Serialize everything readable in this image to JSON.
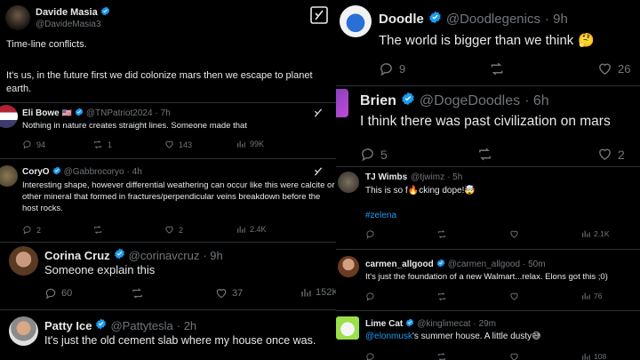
{
  "colors": {
    "background": "#000000",
    "text": "#e7e9ea",
    "muted": "#71767b",
    "verified": "#1d9bf0",
    "link": "#1d9bf0",
    "divider": "#2f3336"
  },
  "top_post": {
    "name": "Davide Masia",
    "handle": "@DavideMasia3",
    "text1": "Time-line conflicts.",
    "text2": "It's us, in the future first we did colonize mars then we escape to planet earth."
  },
  "left": [
    {
      "name": "Eli Bowe",
      "flag": "🇺🇸",
      "handle": "@TNPatriot2024",
      "time": "· 7h",
      "text": "Nothing in nature creates straight lines. Someone made that",
      "replies": "94",
      "reposts": "1",
      "likes": "143",
      "views": "99K"
    },
    {
      "name": "CoryO",
      "handle": "@Gabbrocoryo",
      "time": "· 4h",
      "text": "Interesting shape, however differential weathering can occur like this were calcite or other mineral that formed in fractures/perpendicular veins breakdown before the host rocks.",
      "replies": "2",
      "reposts": "",
      "likes": "2",
      "views": "2.4K"
    },
    {
      "name": "Corina Cruz",
      "handle": "@corinavcruz",
      "time": "· 9h",
      "text": "Someone explain this",
      "replies": "60",
      "reposts": "",
      "likes": "37",
      "views": "152K"
    },
    {
      "name": "Patty Ice",
      "handle": "@Pattytesla",
      "time": "· 2h",
      "text": "It's just the old cement slab where my house once was."
    }
  ],
  "right": [
    {
      "name": "Doodle",
      "handle": "@Doodlegenics",
      "time": "· 9h",
      "text": "The world is bigger than we think",
      "emoji": "🤔",
      "replies": "9",
      "reposts": "",
      "likes": "26"
    },
    {
      "name": "Brien",
      "handle": "@DogeDoodles",
      "time": "· 6h",
      "text": "I think there was past civilization on mars",
      "replies": "5",
      "reposts": "",
      "likes": "2"
    },
    {
      "name": "TJ Wimbs",
      "handle": "@tjwimz",
      "time": "· 5h",
      "text_a": "This is so f",
      "emoji_a": "🔥",
      "text_b": "cking dope!",
      "emoji_b": "🤯",
      "hashtag": "#zelena",
      "views": "2.1K"
    },
    {
      "name": "carmen_allgood",
      "handle": "@carmen_allgood",
      "time": "· 50m",
      "text": "It's just the foundation of a new  Walmart...relax. Elons got this ;0)",
      "views": "76"
    },
    {
      "name": "Lime Cat",
      "handle": "@kinglimecat",
      "time": "· 29m",
      "mention": "@elonmusk",
      "text": "'s summer house. A little dusty",
      "emoji": "😅",
      "views": "108"
    }
  ],
  "icons": [
    "verified-badge-icon",
    "grok-icon",
    "reply-icon",
    "repost-icon",
    "like-icon",
    "views-icon"
  ]
}
